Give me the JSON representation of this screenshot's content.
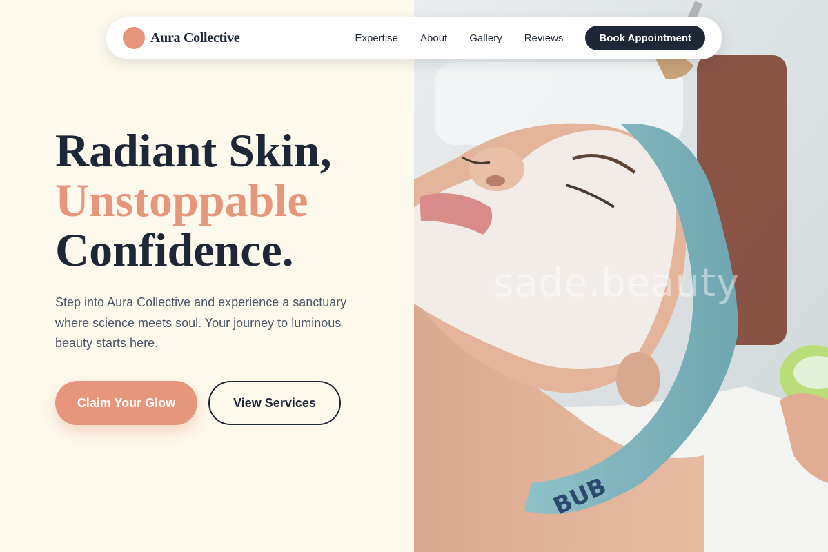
{
  "brand": {
    "name": "Aura Collective",
    "accent_color": "#e6967a",
    "dark_color": "#1e2738"
  },
  "nav": {
    "links": [
      "Expertise",
      "About",
      "Gallery",
      "Reviews"
    ],
    "cta_label": "Book Appointment"
  },
  "hero": {
    "headline_line1": "Radiant Skin,",
    "headline_line2": "Unstoppable",
    "headline_line3": "Confidence.",
    "lede": "Step into Aura Collective and experience a sanctuary where science meets soul. Your journey to luminous beauty starts here.",
    "primary_cta": "Claim Your Glow",
    "secondary_cta": "View Services"
  },
  "image": {
    "watermark": "sade.beauty",
    "towel_text": "BUB"
  }
}
